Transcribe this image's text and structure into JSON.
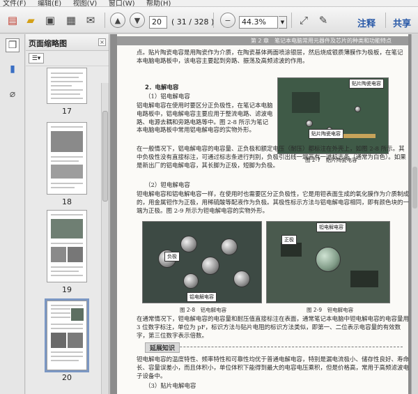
{
  "menu": {
    "items": [
      "文件(F)",
      "编辑(E)",
      "视图(V)",
      "窗口(W)",
      "帮助(H)"
    ]
  },
  "toolbar": {
    "page_current": "20",
    "page_count": "( 31 / 328 )",
    "zoom": "44.3%",
    "annotate_label": "注释",
    "share_label": "共享"
  },
  "thumbnails": {
    "title": "页面缩略图",
    "pages": [
      {
        "label": "17",
        "selected": false
      },
      {
        "label": "18",
        "selected": false
      },
      {
        "label": "19",
        "selected": false
      },
      {
        "label": "20",
        "selected": true
      }
    ]
  },
  "document": {
    "running_head": "第 2 章　笔记本电脑常用元器件及芯片的种类和功能特点",
    "para1": "点。贴片陶瓷电容是用陶瓷作为介质，在陶瓷基体两面喷涂银层，然后烧成银质薄膜作为极板，在笔记本电脑电路板中，该电容主要起到旁路、振荡及高频滤波的作用。",
    "section2": "2．电解电容",
    "sub1": "（1）铝电解电容",
    "para2": "铝电解电容在使用时要区分正负极性，在笔记本电脑电路板中，铝电解电容主要应用于整流电路、滤波电路、电源去耦和旁路电路等中。图 2-8 所示为笔记本电脑电路板中常用铝电解电容的实物外形。",
    "para3": "在一般情况下，铝电解电容的电容量、正负极和额定电压（耐压）都标注在外壳上，如图 2-8 所示。其中负极性没有直接标注，可通过标志条进行判别，负极引出线一端画有一道标志条（通常为白色）。如果是新出厂的铝电解电容，其长脚为正极，短脚为负极。",
    "sub2": "（2）钽电解电容",
    "para4": "钽电解电容和铝电解电容一样，在使用时也需要区分正负极性，它是用钽表面生成的氧化膜作为介质制成的，用金属钽作为正极，用稀硫酸等配液作为负极。其极性标示方法与铝电解电容相同，即有颜色块的一端为正极。图 2-9 所示为钽电解电容的实物外形。",
    "para5": "在通常情况下，钽电解电容的电容量和耐压值直接标注在表面，通常笔记本电脑中钽电解电容的电容量用 3 位数字标注，单位为 pF，标识方法与贴片电阻的标识方法类似，即第一、二位表示电容量的有效数字，第三位数字表示倍数。",
    "ext_title": "延展知识",
    "ext_text": "钽电解电容的温度特性、频率特性和可靠性均优于普通电解电容，特别是漏电流极小、储存性良好、寿命长、容量误差小，而且体积小，单位体积下能得到最大的电容电压乘积，但是价格高，常用于高频滤波电子设备中。",
    "sub3": "（3）贴片电解电容",
    "fig7_label_top": "贴片陶瓷电容",
    "fig7_label_bottom": "贴片陶瓷电容",
    "fig7_caption": "图 2-7　贴片陶瓷电容",
    "fig8_label_neg": "负极",
    "fig8_label_main": "铝电解电容",
    "fig8_caption": "图 2-8　铝电解电容",
    "fig9_label_main": "钽电解电容",
    "fig9_label_pos": "正极",
    "fig9_caption": "图 2-9　钽电解电容"
  }
}
